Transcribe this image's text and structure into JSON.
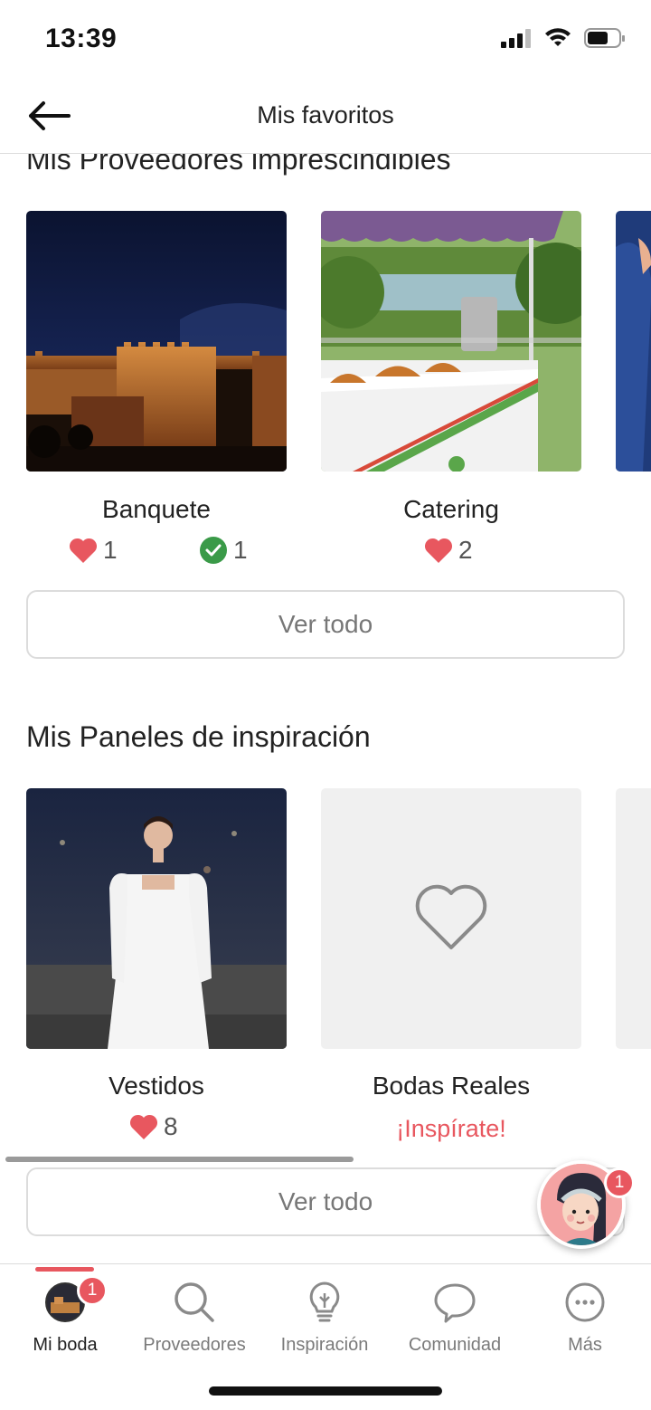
{
  "status": {
    "time": "13:39"
  },
  "header": {
    "title": "Mis favoritos"
  },
  "providers": {
    "title": "Mis Proveedores imprescindibles",
    "cards": [
      {
        "label": "Banquete",
        "likes": "1",
        "booked": "1"
      },
      {
        "label": "Catering",
        "likes": "2"
      }
    ],
    "see_all": "Ver todo"
  },
  "boards": {
    "title": "Mis Paneles de inspiración",
    "cards": [
      {
        "label": "Vestidos",
        "likes": "8"
      },
      {
        "label": "Bodas Reales",
        "cta": "¡Inspírate!"
      }
    ],
    "see_all": "Ver todo"
  },
  "assistant": {
    "badge": "1"
  },
  "nav": {
    "items": [
      {
        "label": "Mi boda",
        "badge": "1",
        "active": true
      },
      {
        "label": "Proveedores"
      },
      {
        "label": "Inspiración"
      },
      {
        "label": "Comunidad"
      },
      {
        "label": "Más"
      }
    ]
  },
  "colors": {
    "accent": "#e8575f",
    "check": "#3a9a48",
    "border": "#dcdcdc"
  },
  "icons": [
    "back-arrow-icon",
    "heart-icon",
    "check-circle-icon",
    "heart-outline-icon",
    "search-icon",
    "lightbulb-icon",
    "chat-bubble-icon",
    "more-dots-icon"
  ]
}
